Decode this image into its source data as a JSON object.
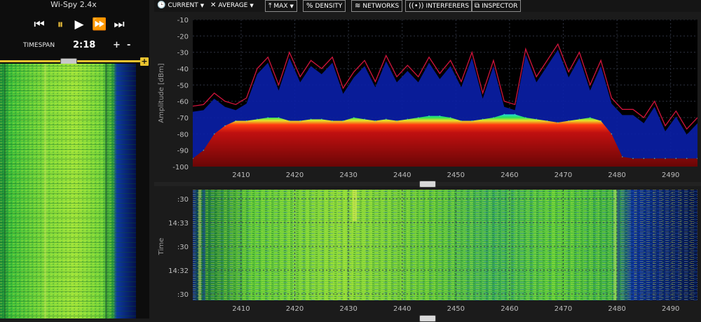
{
  "left_panel": {
    "device_title": "Wi-Spy 2.4x",
    "timespan_label": "TIMESPAN",
    "timespan_value": "2:18",
    "plus": "+",
    "minus": "-"
  },
  "toolbar": {
    "current": "CURRENT",
    "average": "AVERAGE",
    "max": "MAX",
    "density": "DENSITY",
    "networks": "NETWORKS",
    "interferers": "INTERFERERS",
    "inspector": "INSPECTOR"
  },
  "colors": {
    "panel_bg": "#1b1b1b",
    "chart_bg": "#000000",
    "average_fill": "#0a1fa8",
    "max_line": "#d1143c",
    "accent": "#e9c32f",
    "grid": "#2e3340"
  },
  "chart_data": [
    {
      "type": "line",
      "ylabel": "Amplitude [dBm]",
      "ylim": [
        -100,
        -10
      ],
      "xlim": [
        2401,
        2495
      ],
      "x_ticks": [
        2410,
        2420,
        2430,
        2440,
        2450,
        2460,
        2470,
        2480,
        2490
      ],
      "y_ticks": [
        -10,
        -20,
        -30,
        -40,
        -50,
        -60,
        -70,
        -80,
        -90,
        -100
      ],
      "series": [
        {
          "values": [
            -95,
            -90,
            -80,
            -75,
            -72,
            -72,
            -71,
            -70,
            -70,
            -72,
            -72,
            -71,
            -71,
            -72,
            -72,
            -70,
            -71,
            -72,
            -71,
            -72,
            -71,
            -70,
            -69,
            -69,
            -70,
            -72,
            -72,
            -71,
            -70,
            -68,
            -68,
            -70,
            -71,
            -72,
            -73,
            -72,
            -71,
            -70,
            -72,
            -80,
            -94,
            -95,
            -95,
            -95,
            -95,
            -95,
            -95,
            -95
          ],
          "x_start": 2401,
          "x_step": 2
        },
        {
          "values": [
            -63,
            -62,
            -55,
            -60,
            -62,
            -58,
            -40,
            -33,
            -50,
            -30,
            -45,
            -35,
            -40,
            -33,
            -52,
            -42,
            -35,
            -48,
            -32,
            -45,
            -38,
            -45,
            -33,
            -43,
            -35,
            -48,
            -30,
            -55,
            -35,
            -60,
            -62,
            -28,
            -45,
            -35,
            -25,
            -42,
            -30,
            -50,
            -35,
            -58,
            -65,
            -65,
            -70,
            -60,
            -75,
            -66,
            -77,
            -70
          ],
          "x_start": 2401,
          "x_step": 2
        }
      ]
    },
    {
      "type": "heatmap",
      "ylabel": "Time",
      "y_ticks": [
        ":30",
        "14:33",
        ":30",
        "14:32",
        ":30"
      ],
      "x_ticks": [
        2410,
        2420,
        2430,
        2440,
        2450,
        2460,
        2470,
        2480,
        2490
      ],
      "xlim": [
        2401,
        2495
      ]
    }
  ]
}
